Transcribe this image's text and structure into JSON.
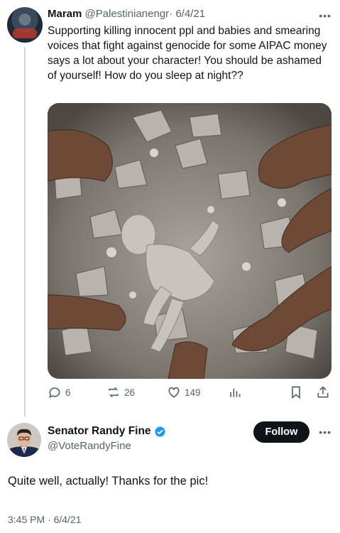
{
  "tweet": {
    "author_name": "Maram",
    "author_handle": "@Palestinianengr",
    "date": "· 6/4/21",
    "text": "Supporting killing innocent ppl and babies and smearing voices that fight against genocide for some AIPAC money says a lot about your character! You should be ashamed of yourself! How do you sleep at night??",
    "stats": {
      "replies": "6",
      "reposts": "26",
      "likes": "149"
    },
    "icons": [
      "reply-icon",
      "repost-icon",
      "like-icon",
      "views-icon",
      "bookmark-icon",
      "share-icon"
    ]
  },
  "reply": {
    "author_name": "Senator Randy Fine",
    "author_handle": "@VoteRandyFine",
    "follow_label": "Follow",
    "text": "Quite well, actually!  Thanks for the pic!",
    "timestamp": "3:45 PM · 6/4/21"
  },
  "colors": {
    "text": "#0f1419",
    "secondary": "#536471",
    "verified": "#1d9bf0",
    "follow_bg": "#0f1419"
  }
}
